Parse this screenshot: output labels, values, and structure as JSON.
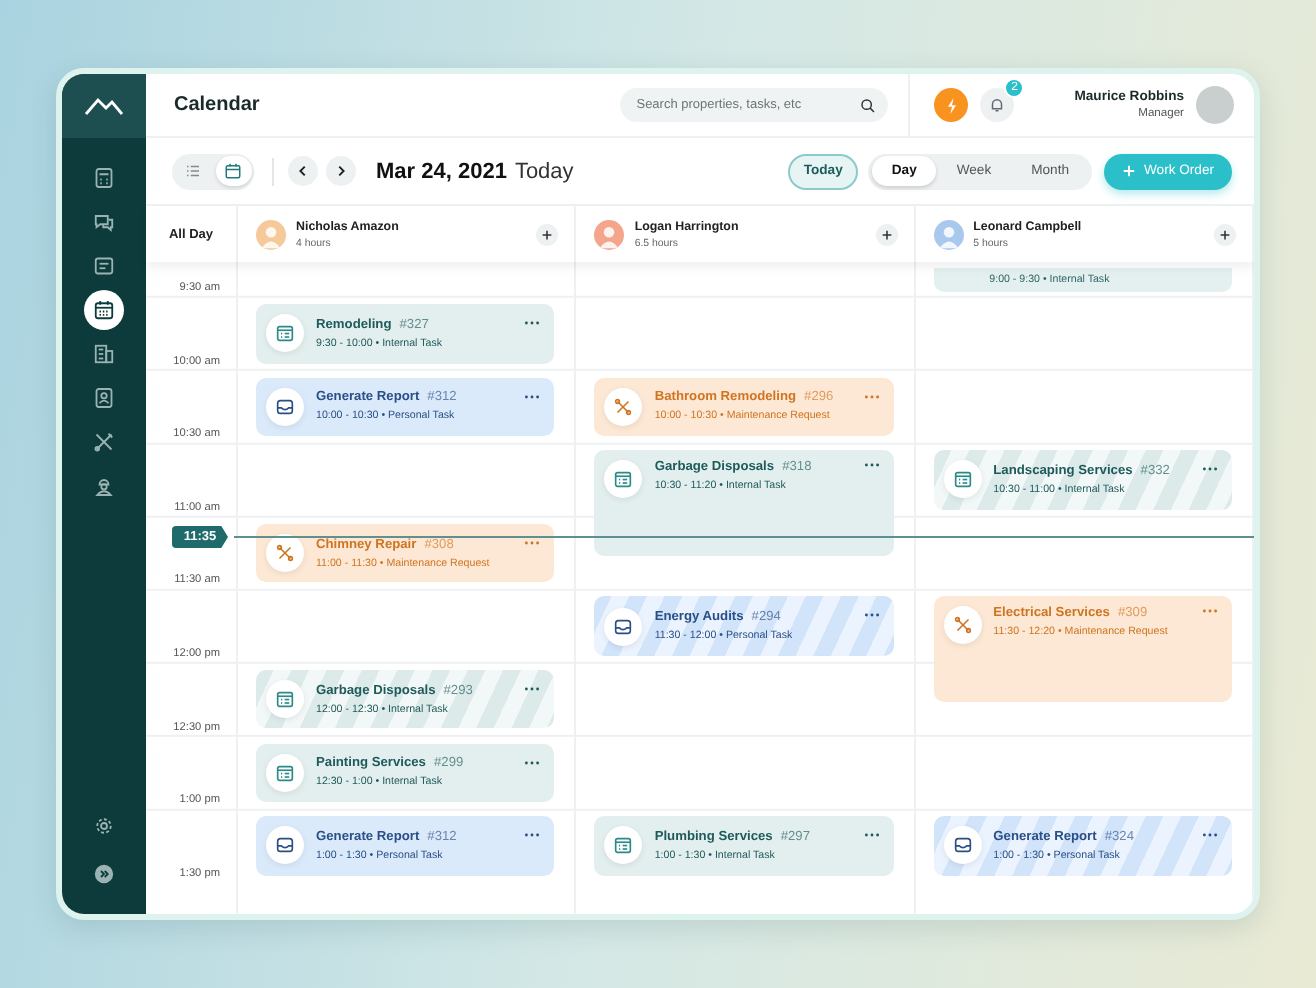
{
  "sidebar": {
    "items": [
      {
        "kind": "calculator",
        "selected": false
      },
      {
        "kind": "chat",
        "selected": false
      },
      {
        "kind": "notes",
        "selected": false
      },
      {
        "kind": "calendar",
        "selected": true
      },
      {
        "kind": "building",
        "selected": false
      },
      {
        "kind": "contact",
        "selected": false
      },
      {
        "kind": "tools",
        "selected": false
      },
      {
        "kind": "worker",
        "selected": false
      }
    ],
    "bottom_items": [
      {
        "kind": "settings",
        "selected": false
      },
      {
        "kind": "exit",
        "selected": false
      }
    ]
  },
  "header": {
    "title": "Calendar",
    "search": {
      "placeholder": "Search properties, tasks, etc"
    },
    "notification_count": "2",
    "user": {
      "name": "Maurice Robbins",
      "role": "Manager"
    }
  },
  "toolbar": {
    "views": [
      {
        "kind": "list",
        "selected": false
      },
      {
        "kind": "calendar",
        "selected": true
      }
    ],
    "date": "Mar 24, 2021",
    "date_note": "Today",
    "today_button": "Today",
    "ranges": [
      {
        "label": "Day",
        "selected": true
      },
      {
        "label": "Week",
        "selected": false
      },
      {
        "label": "Month",
        "selected": false
      }
    ],
    "work_order_button": "Work Order"
  },
  "calendar": {
    "all_day_label": "All Day",
    "time_labels": [
      "9:30 am",
      "10:00 am",
      "10:30 am",
      "11:00 am",
      "11:30 am",
      "12:00 pm",
      "12:30 pm",
      "1:00 pm",
      "1:30 pm"
    ],
    "now_time": "11:35",
    "people": [
      {
        "name": "Nicholas Amazon",
        "hours": "4 hours",
        "color": "#f6c99a",
        "slots": [
          {
            "kind": "internal",
            "title": "Remodeling",
            "number": "#327",
            "meta": "9:30 - 10:00 • Internal Task",
            "striped": false,
            "tall": false
          },
          {
            "kind": "personal",
            "title": "Generate Report",
            "number": "#312",
            "meta": "10:00 - 10:30 • Personal Task",
            "striped": false,
            "tall": false
          },
          {
            "kind": "empty"
          },
          {
            "kind": "maintenance",
            "title": "Chimney Repair",
            "number": "#308",
            "meta": "11:00 - 11:30 • Maintenance Request",
            "striped": false,
            "tall": false
          },
          {
            "kind": "empty"
          },
          {
            "kind": "internal",
            "title": "Garbage Disposals",
            "number": "#293",
            "meta": "12:00 - 12:30 • Internal Task",
            "striped": true,
            "tall": false
          },
          {
            "kind": "internal",
            "title": "Painting Services",
            "number": "#299",
            "meta": "12:30 - 1:00 • Internal Task",
            "striped": false,
            "tall": false
          },
          {
            "kind": "personal",
            "title": "Generate Report",
            "number": "#312",
            "meta": "1:00 - 1:30 • Personal Task",
            "striped": false,
            "tall": false
          }
        ]
      },
      {
        "name": "Logan Harrington",
        "hours": "6.5 hours",
        "color": "#f4a58c",
        "slots": [
          {
            "kind": "empty"
          },
          {
            "kind": "maintenance",
            "title": "Bathroom Remodeling",
            "number": "#296",
            "meta": "10:00 - 10:30 • Maintenance Request",
            "striped": false,
            "tall": false
          },
          {
            "kind": "internal",
            "title": "Garbage Disposals",
            "number": "#318",
            "meta": "10:30 - 11:20 • Internal Task",
            "striped": false,
            "tall": true
          },
          {
            "kind": "personal",
            "title": "Energy Audits",
            "number": "#294",
            "meta": "11:30 - 12:00 • Personal Task",
            "striped": true,
            "tall": false
          },
          {
            "kind": "empty"
          },
          {
            "kind": "empty"
          },
          {
            "kind": "internal",
            "title": "Plumbing Services",
            "number": "#297",
            "meta": "1:00 - 1:30 • Internal Task",
            "striped": false,
            "tall": false
          }
        ]
      },
      {
        "name": "Leonard Campbell",
        "hours": "5 hours",
        "color": "#a9c8ee",
        "carry_over": "9:00 - 9:30 • Internal Task",
        "slots": [
          {
            "kind": "empty"
          },
          {
            "kind": "empty"
          },
          {
            "kind": "internal",
            "title": "Landscaping Services",
            "number": "#332",
            "meta": "10:30 - 11:00 • Internal Task",
            "striped": true,
            "tall": false
          },
          {
            "kind": "empty"
          },
          {
            "kind": "maintenance",
            "title": "Electrical Services",
            "number": "#309",
            "meta": "11:30 - 12:20 • Maintenance Request",
            "striped": false,
            "tall": true
          },
          {
            "kind": "empty"
          },
          {
            "kind": "personal",
            "title": "Generate Report",
            "number": "#324",
            "meta": "1:00 - 1:30 • Personal Task",
            "striped": true,
            "tall": false
          }
        ]
      }
    ]
  }
}
